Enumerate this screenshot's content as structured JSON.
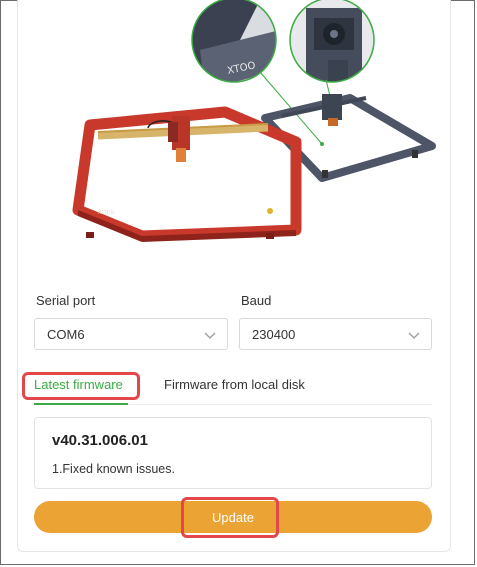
{
  "serial": {
    "label": "Serial port",
    "value": "COM6"
  },
  "baud": {
    "label": "Baud",
    "value": "230400"
  },
  "tabs": [
    {
      "label": "Latest firmware",
      "active": true
    },
    {
      "label": "Firmware from local disk",
      "active": false
    }
  ],
  "firmware": {
    "version": "v40.31.006.01",
    "notes": "1.Fixed known issues."
  },
  "update_button": {
    "label": "Update"
  },
  "machine_brand": "XTOOL",
  "colors": {
    "accent": "#3cab44",
    "button": "#eba333",
    "highlight": "#e2474c",
    "machine_red": "#c8382b"
  },
  "icons": [
    "chevron-down-icon"
  ]
}
